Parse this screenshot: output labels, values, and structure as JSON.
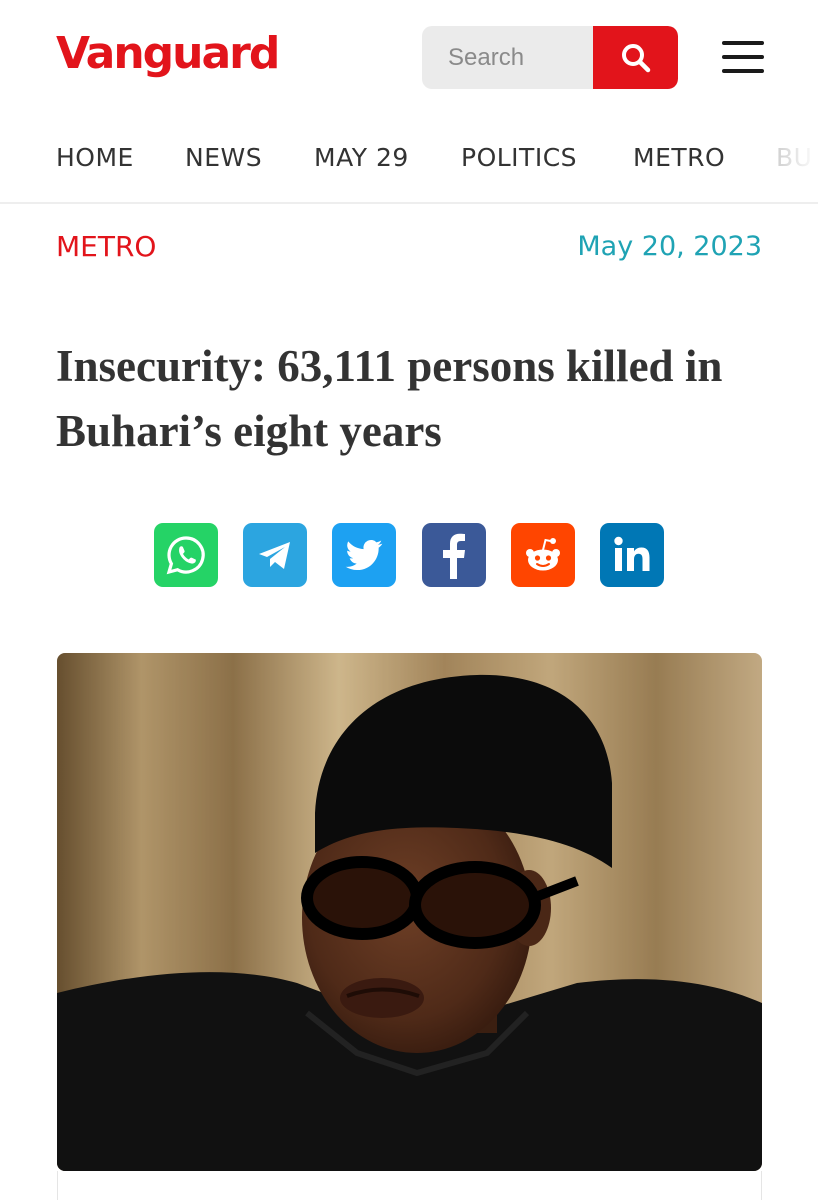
{
  "header": {
    "logo": "Vanguard",
    "search_placeholder": "Search",
    "search_icon": "search-icon",
    "menu_icon": "hamburger-menu-icon"
  },
  "nav": {
    "items": [
      "HOME",
      "NEWS",
      "MAY 29",
      "POLITICS",
      "METRO",
      "BU"
    ]
  },
  "article": {
    "category": "METRO",
    "date": "May 20, 2023",
    "headline": "Insecurity: 63,111 persons killed in Buhari’s eight years"
  },
  "share": [
    {
      "icon": "whatsapp-icon",
      "color": "#25d366"
    },
    {
      "icon": "telegram-icon",
      "color": "#2ca5e0"
    },
    {
      "icon": "twitter-icon",
      "color": "#1da1f2"
    },
    {
      "icon": "facebook-icon",
      "color": "#3b5998"
    },
    {
      "icon": "reddit-icon",
      "color": "#ff4500"
    },
    {
      "icon": "linkedin-icon",
      "color": "#0077b5"
    }
  ],
  "colors": {
    "brand": "#e2141b",
    "date": "#1fa3b4",
    "text": "#333333"
  }
}
